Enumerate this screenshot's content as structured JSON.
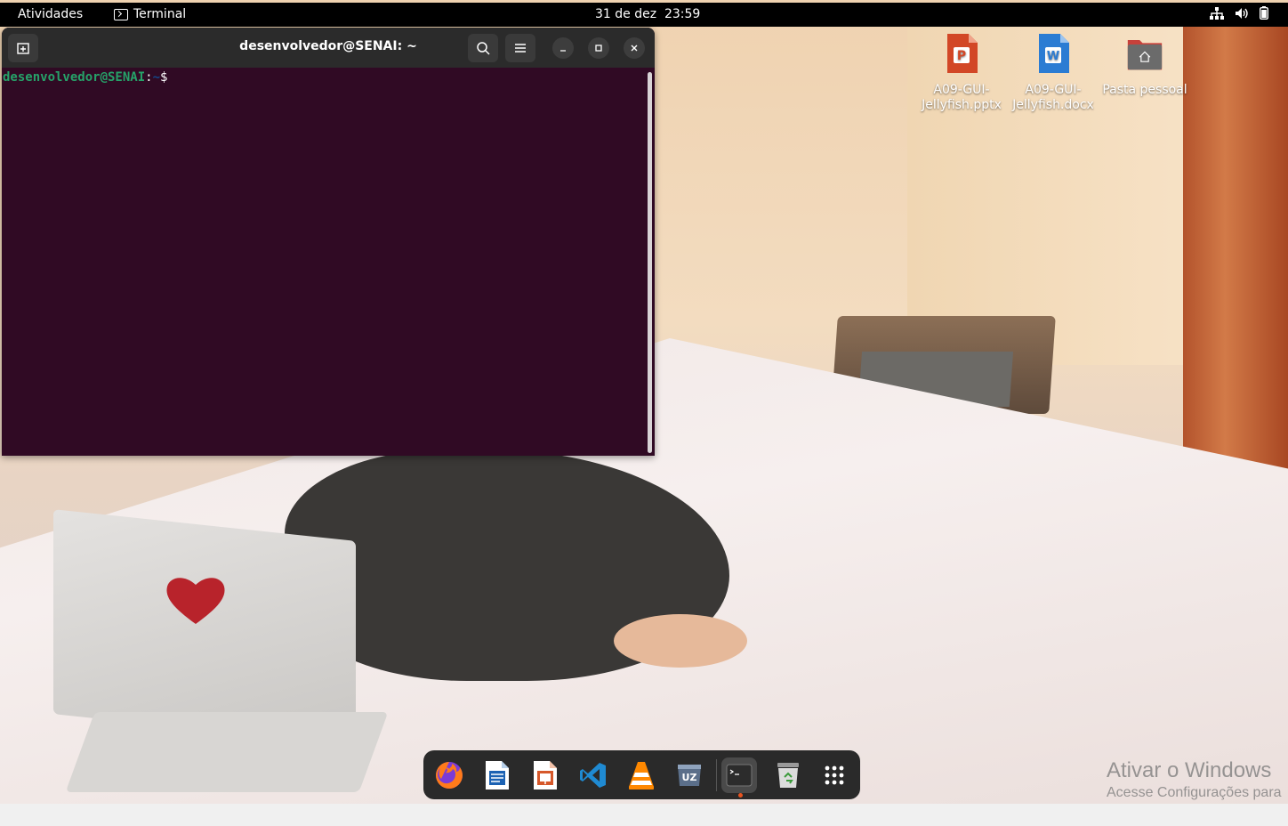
{
  "topbar": {
    "activities": "Atividades",
    "app_name": "Terminal",
    "clock": "31 de dez  23:59",
    "tray_icons": [
      "network-icon",
      "volume-icon",
      "battery-icon"
    ]
  },
  "terminal": {
    "title": "desenvolvedor@SENAI: ~",
    "prompt_user": "desenvolvedor@SENAI",
    "prompt_colon": ":",
    "prompt_path": "~",
    "prompt_symbol": "$",
    "header_icons": [
      "new-tab-icon",
      "search-icon",
      "menu-icon",
      "minimize-icon",
      "maximize-icon",
      "close-icon"
    ]
  },
  "desktop_icons": [
    {
      "label": "A09-GUI-Jellyfish.pptx",
      "icon": "powerpoint-file-icon",
      "color": "#d24726",
      "letter": "P"
    },
    {
      "label": "A09-GUI-Jellyfish.docx",
      "icon": "word-file-icon",
      "color": "#2b7cd3",
      "letter": "W"
    },
    {
      "label": "Pasta pessoal",
      "icon": "home-folder-icon",
      "color": "#c7413b"
    }
  ],
  "dock": [
    {
      "name": "firefox",
      "icon": "firefox-icon"
    },
    {
      "name": "libreoffice-writer",
      "icon": "writer-icon"
    },
    {
      "name": "libreoffice-impress",
      "icon": "impress-icon"
    },
    {
      "name": "vscode",
      "icon": "vscode-icon"
    },
    {
      "name": "vlc",
      "icon": "vlc-icon"
    },
    {
      "name": "archive-manager",
      "icon": "archive-icon"
    },
    {
      "name": "terminal",
      "icon": "terminal-icon",
      "active": true
    },
    {
      "name": "trash",
      "icon": "trash-icon"
    },
    {
      "name": "show-applications",
      "icon": "app-grid-icon"
    }
  ],
  "watermark": {
    "line1": "Ativar o Windows",
    "line2": "Acesse Configurações para"
  },
  "colors": {
    "terminal_bg": "#300a24",
    "prompt_user": "#26a269",
    "prompt_path": "#12488b",
    "topbar_bg": "#000000",
    "dock_bg": "#2a2a2a"
  }
}
